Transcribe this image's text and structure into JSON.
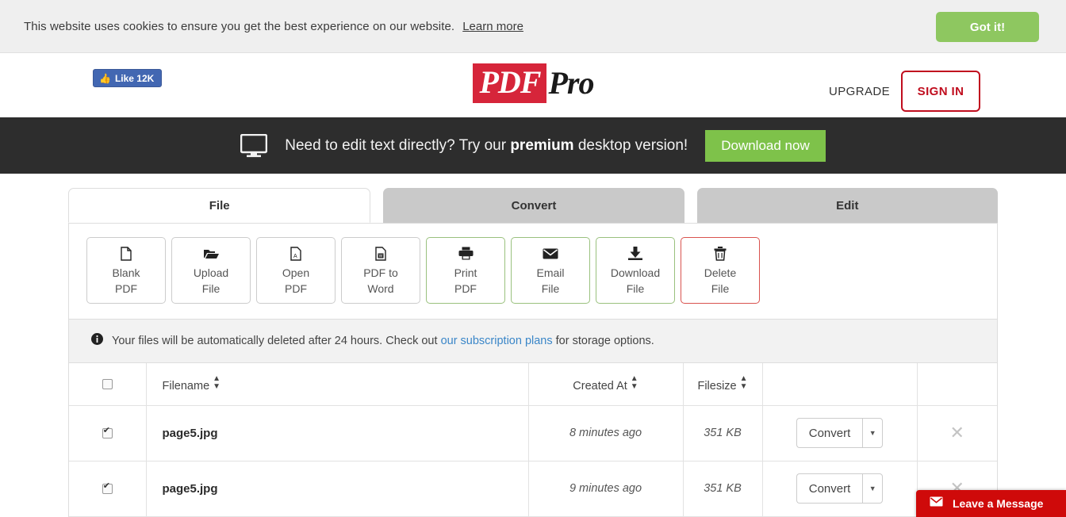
{
  "cookie": {
    "message": "This website uses cookies to ensure you get the best experience on our website.",
    "learn_more": "Learn more",
    "accept_label": "Got it!",
    "accept_color": "#8ec760"
  },
  "header": {
    "facebook_like_label": "Like 12K",
    "logo_part1": "PDF",
    "logo_part2": "Pro",
    "logo_color": "#d6253a",
    "upgrade_label": "UPGRADE",
    "signin_label": "SIGN IN",
    "signin_color": "#c00d1e"
  },
  "promo": {
    "text_before": "Need to edit text directly? Try our ",
    "text_bold": "premium",
    "text_after": " desktop version!",
    "button_label": "Download now",
    "button_color": "#7ec24a",
    "background": "#2d2d2d",
    "icon": "monitor-icon"
  },
  "tabs": [
    {
      "label": "File",
      "active": true
    },
    {
      "label": "Convert",
      "active": false
    },
    {
      "label": "Edit",
      "active": false
    }
  ],
  "toolbar": [
    {
      "line1": "Blank",
      "line2": "PDF",
      "icon": "blank-page-icon",
      "style": "default"
    },
    {
      "line1": "Upload",
      "line2": "File",
      "icon": "folder-open-icon",
      "style": "default"
    },
    {
      "line1": "Open",
      "line2": "PDF",
      "icon": "pdf-file-icon",
      "style": "default"
    },
    {
      "line1": "PDF to",
      "line2": "Word",
      "icon": "word-file-icon",
      "style": "default"
    },
    {
      "line1": "Print",
      "line2": "PDF",
      "icon": "printer-icon",
      "style": "green"
    },
    {
      "line1": "Email",
      "line2": "File",
      "icon": "envelope-icon",
      "style": "green"
    },
    {
      "line1": "Download",
      "line2": "File",
      "icon": "download-icon",
      "style": "green"
    },
    {
      "line1": "Delete",
      "line2": "File",
      "icon": "trash-icon",
      "style": "red"
    }
  ],
  "notice": {
    "icon": "info-circle-icon",
    "text_before": "Your files will be automatically deleted after 24 hours. Check out ",
    "link": "our subscription plans",
    "text_after": " for storage options."
  },
  "table": {
    "columns": {
      "filename": "Filename",
      "created_at": "Created At",
      "filesize": "Filesize"
    },
    "select_all_checked": false,
    "rows": [
      {
        "checked": true,
        "filename": "page5.jpg",
        "created_at": "8 minutes ago",
        "filesize": "351 KB",
        "action_label": "Convert",
        "remove_label": "✕"
      },
      {
        "checked": true,
        "filename": "page5.jpg",
        "created_at": "9 minutes ago",
        "filesize": "351 KB",
        "action_label": "Convert",
        "remove_label": "✕"
      }
    ]
  },
  "chat_widget": {
    "label": "Leave a Message",
    "icon": "envelope-icon",
    "color": "#cf0a0a"
  }
}
